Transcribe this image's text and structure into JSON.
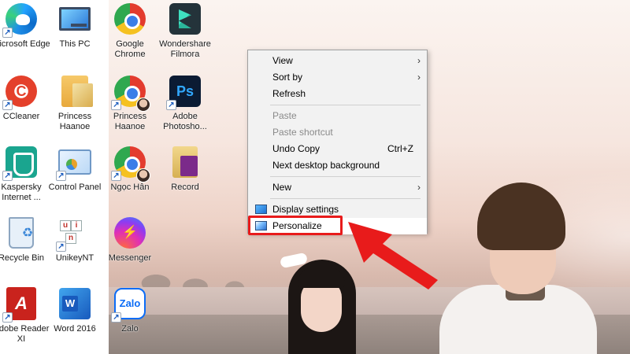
{
  "desktop": {
    "icons": [
      {
        "label": "Microsoft Edge",
        "icon": "edge-icon"
      },
      {
        "label": "This PC",
        "icon": "this-pc-icon"
      },
      {
        "label": "Google Chrome",
        "icon": "chrome-icon"
      },
      {
        "label": "Wondershare Filmora",
        "icon": "filmora-icon"
      },
      {
        "label": "CCleaner",
        "icon": "ccleaner-icon"
      },
      {
        "label": "Princess Haanoe",
        "icon": "folder-icon"
      },
      {
        "label": "Princess Haanoe",
        "icon": "chrome-profile-icon"
      },
      {
        "label": "Adobe Photosho...",
        "icon": "photoshop-icon"
      },
      {
        "label": "Kaspersky Internet ...",
        "icon": "kaspersky-icon"
      },
      {
        "label": "Control Panel",
        "icon": "control-panel-icon"
      },
      {
        "label": "Ngọc Hân",
        "icon": "chrome-profile-icon"
      },
      {
        "label": "Record",
        "icon": "folder-icon"
      },
      {
        "label": "Recycle Bin",
        "icon": "recycle-bin-icon"
      },
      {
        "label": "UnikeyNT",
        "icon": "unikey-icon"
      },
      {
        "label": "Messenger",
        "icon": "messenger-icon"
      },
      {
        "label": "Adobe Reader XI",
        "icon": "acrobat-icon"
      },
      {
        "label": "Word 2016",
        "icon": "word-icon"
      },
      {
        "label": "Zalo",
        "icon": "zalo-icon"
      }
    ],
    "photoshop_glyph": "Ps",
    "zalo_glyph": "Zalo",
    "unikey_keys": [
      "u",
      "i",
      "n"
    ]
  },
  "context_menu": {
    "items": [
      {
        "label": "View",
        "submenu": true
      },
      {
        "label": "Sort by",
        "submenu": true
      },
      {
        "label": "Refresh"
      },
      {
        "label": "Paste",
        "disabled": true
      },
      {
        "label": "Paste shortcut",
        "disabled": true
      },
      {
        "label": "Undo Copy",
        "shortcut": "Ctrl+Z"
      },
      {
        "label": "Next desktop background"
      },
      {
        "label": "New",
        "submenu": true
      },
      {
        "label": "Display settings",
        "icon": "display-settings-icon"
      },
      {
        "label": "Personalize",
        "icon": "personalize-icon"
      }
    ],
    "submenu_arrow": "›"
  },
  "annotation": {
    "highlight_color": "#e81b1b",
    "arrow_color": "#e81b1b"
  }
}
